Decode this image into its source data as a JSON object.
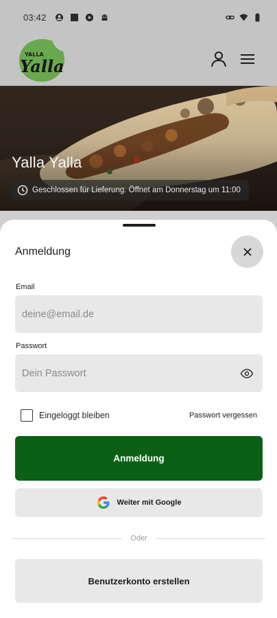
{
  "status_bar": {
    "time": "03:42",
    "icons_left": [
      "face-icon",
      "square-icon",
      "shield-play-icon",
      "android-icon"
    ],
    "icons_right": [
      "link-icon",
      "wifi-icon",
      "battery-icon"
    ]
  },
  "header": {
    "logo_text_top": "YALLA",
    "logo_text_main": "Yalla",
    "logo_color": "#6aa84f",
    "account_icon": "account-icon",
    "menu_icon": "menu-icon"
  },
  "hero": {
    "restaurant_name": "Yalla Yalla",
    "delivery_status": "Geschlossen für Lieferung. Öffnet am Donnerstag um 11:00",
    "status_icon": "clock-icon"
  },
  "login_sheet": {
    "title": "Anmeldung",
    "close_icon": "close-icon",
    "email": {
      "label": "Email",
      "placeholder": "deine@email.de",
      "value": ""
    },
    "password": {
      "label": "Passwort",
      "placeholder": "Dein Passwort",
      "value": "",
      "toggle_icon": "eye-icon"
    },
    "remember_me": {
      "label": "Eingeloggt bleiben",
      "checked": false
    },
    "forgot_password_label": "Passwort vergessen",
    "login_button_label": "Anmeldung",
    "google_button_label": "Weiter mit Google",
    "divider_text": "Oder",
    "create_account_label": "Benutzerkonto erstellen"
  },
  "colors": {
    "primary": "#0c6016",
    "field_background": "#e8e8e8",
    "header_background": "#c4c4c4"
  }
}
